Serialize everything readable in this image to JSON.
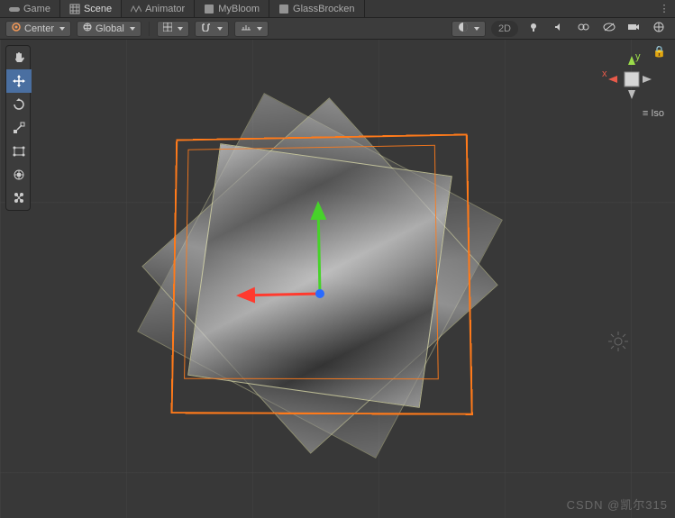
{
  "tabs": [
    {
      "label": "Game",
      "icon": "gamepad-icon",
      "active": false
    },
    {
      "label": "Scene",
      "icon": "scene-icon",
      "active": true
    },
    {
      "label": "Animator",
      "icon": "animator-icon",
      "active": false
    },
    {
      "label": "MyBloom",
      "icon": "csharp-icon",
      "active": false
    },
    {
      "label": "GlassBrocken",
      "icon": "csharp-icon",
      "active": false
    }
  ],
  "toolbar": {
    "pivot": {
      "label": "Center",
      "icon": "#f29856"
    },
    "space": {
      "label": "Global"
    },
    "grid_icon": "grid-icon",
    "snap_icon": "snap-icon",
    "increment_icon": "increment-icon",
    "shade_icon": "shade-icon",
    "mode2d": "2D",
    "right_icons": [
      "light-icon",
      "audio-icon",
      "fx-icon",
      "hidden-icon",
      "camera-icon",
      "gizmos-icon"
    ]
  },
  "tool_dock": [
    {
      "name": "hand-tool",
      "active": false
    },
    {
      "name": "move-tool",
      "active": true
    },
    {
      "name": "rotate-tool",
      "active": false
    },
    {
      "name": "scale-tool",
      "active": false
    },
    {
      "name": "rect-tool",
      "active": false
    },
    {
      "name": "transform-tool",
      "active": false
    },
    {
      "name": "custom-tool",
      "active": false
    }
  ],
  "orientation": {
    "x": "x",
    "y": "y",
    "mode": "Iso",
    "locked": false
  },
  "gizmo": {
    "axes": [
      "x",
      "y",
      "z"
    ],
    "colors": {
      "x": "#ff3a2e",
      "y": "#47d22a",
      "z": "#2a6bff"
    }
  },
  "watermark": "CSDN @凯尔315"
}
